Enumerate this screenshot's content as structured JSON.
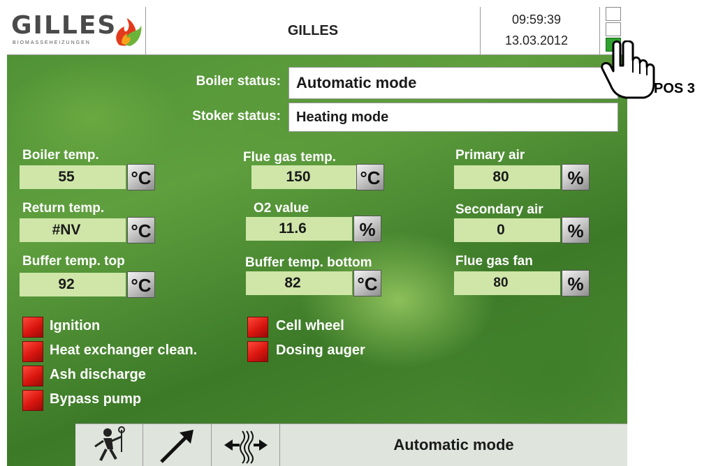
{
  "header": {
    "logo_text": "GILLES",
    "logo_subtext": "BIOMASSEHEIZUNGEN",
    "title": "GILLES",
    "time": "09:59:39",
    "date": "13.03.2012"
  },
  "status": {
    "boiler_label": "Boiler status:",
    "boiler_value": "Automatic mode",
    "stoker_label": "Stoker status:",
    "stoker_value": "Heating mode"
  },
  "measurements": [
    {
      "label": "Boiler temp.",
      "value": "55",
      "unit": "°C"
    },
    {
      "label": "Flue gas temp.",
      "value": "150",
      "unit": "°C"
    },
    {
      "label": "Primary air",
      "value": "80",
      "unit": "%"
    },
    {
      "label": "Return temp.",
      "value": "#NV",
      "unit": "°C"
    },
    {
      "label": "O2 value",
      "value": "11.6",
      "unit": "%"
    },
    {
      "label": "Secondary air",
      "value": "0",
      "unit": "%"
    },
    {
      "label": "Buffer temp. top",
      "value": "92",
      "unit": "°C"
    },
    {
      "label": "Buffer temp. bottom",
      "value": "82",
      "unit": "°C"
    },
    {
      "label": "Flue gas fan",
      "value": "80",
      "unit": "%"
    }
  ],
  "indicators": [
    {
      "label": "Ignition",
      "state": "off",
      "color": "#d9150f"
    },
    {
      "label": "Heat exchanger clean.",
      "state": "off",
      "color": "#d9150f"
    },
    {
      "label": "Ash discharge",
      "state": "off",
      "color": "#d9150f"
    },
    {
      "label": "Bypass pump",
      "state": "off",
      "color": "#d9150f"
    },
    {
      "label": "Cell wheel",
      "state": "off",
      "color": "#d9150f"
    },
    {
      "label": "Dosing auger",
      "state": "off",
      "color": "#d9150f"
    }
  ],
  "footer": {
    "icons": [
      "chimney-sweep-icon",
      "arrow-diagonal-icon",
      "heat-exchange-icon"
    ],
    "mode": "Automatic mode"
  },
  "annotation": {
    "label": "POS 3"
  },
  "colors": {
    "field_bg": "#cfe6a8",
    "active_pos": "#2fa12f",
    "led_red": "#d9150f"
  }
}
